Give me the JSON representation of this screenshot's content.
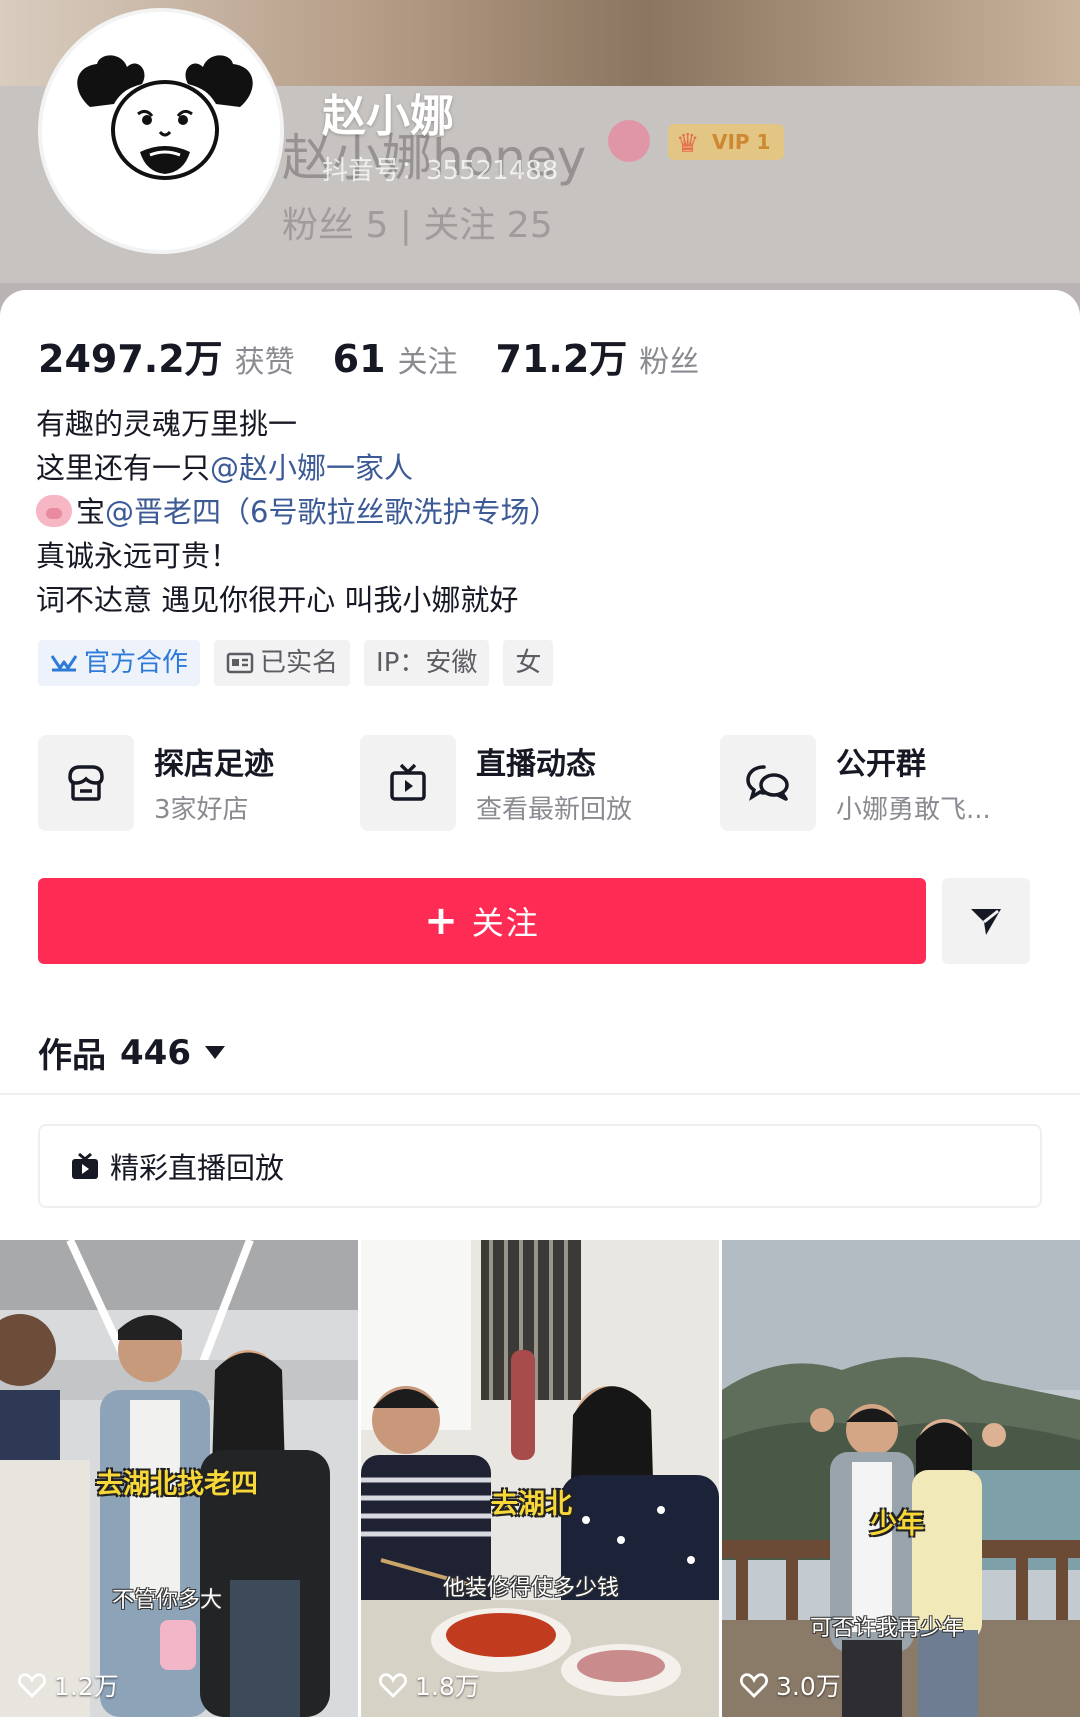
{
  "header": {
    "name": "赵小娜",
    "douyin_id": "抖音号：35521488",
    "ghost_name": "赵小娜honey",
    "ghost_vip": "VIP 1",
    "ghost_fans": "粉丝 5 | 关注 25"
  },
  "stats": [
    {
      "value": "2497.2万",
      "label": "获赞"
    },
    {
      "value": "61",
      "label": "关注"
    },
    {
      "value": "71.2万",
      "label": "粉丝"
    }
  ],
  "bio": {
    "line1": "有趣的灵魂万里挑一",
    "line2_prefix": "这里还有一只",
    "line2_mention": "@赵小娜一家人",
    "line3_prefix": "宝",
    "line3_mention": "@晋老四（6号歌拉丝歌洗护专场）",
    "line4": "真诚永远可贵！",
    "line5": "词不达意 遇见你很开心 叫我小娜就好"
  },
  "tags": {
    "official": "官方合作",
    "verified": "已实名",
    "ip": "IP：安徽",
    "gender": "女"
  },
  "shortcuts": [
    {
      "title": "探店足迹",
      "subtitle": "3家好店",
      "icon": "store-icon"
    },
    {
      "title": "直播动态",
      "subtitle": "查看最新回放",
      "icon": "tv-icon"
    },
    {
      "title": "公开群",
      "subtitle": "小娜勇敢飞...",
      "icon": "chat-bubbles-icon"
    }
  ],
  "follow_button": {
    "label": "关注"
  },
  "works_tab": {
    "label": "作品",
    "count": "446"
  },
  "live_replay": {
    "label": "精彩直播回放"
  },
  "videos": [
    {
      "title": "去湖北找老四",
      "caption": "不管你多大",
      "likes": "1.2万"
    },
    {
      "title": "去湖北",
      "caption": "他装修得使多少钱",
      "likes": "1.8万"
    },
    {
      "title": "少年",
      "caption": "可否许我再少年",
      "likes": "3.0万"
    }
  ],
  "colors": {
    "accent": "#fe2c55",
    "mention": "#3c5a96",
    "official_tag": "#2d7ad8",
    "secondary_text": "#8a8b91"
  }
}
